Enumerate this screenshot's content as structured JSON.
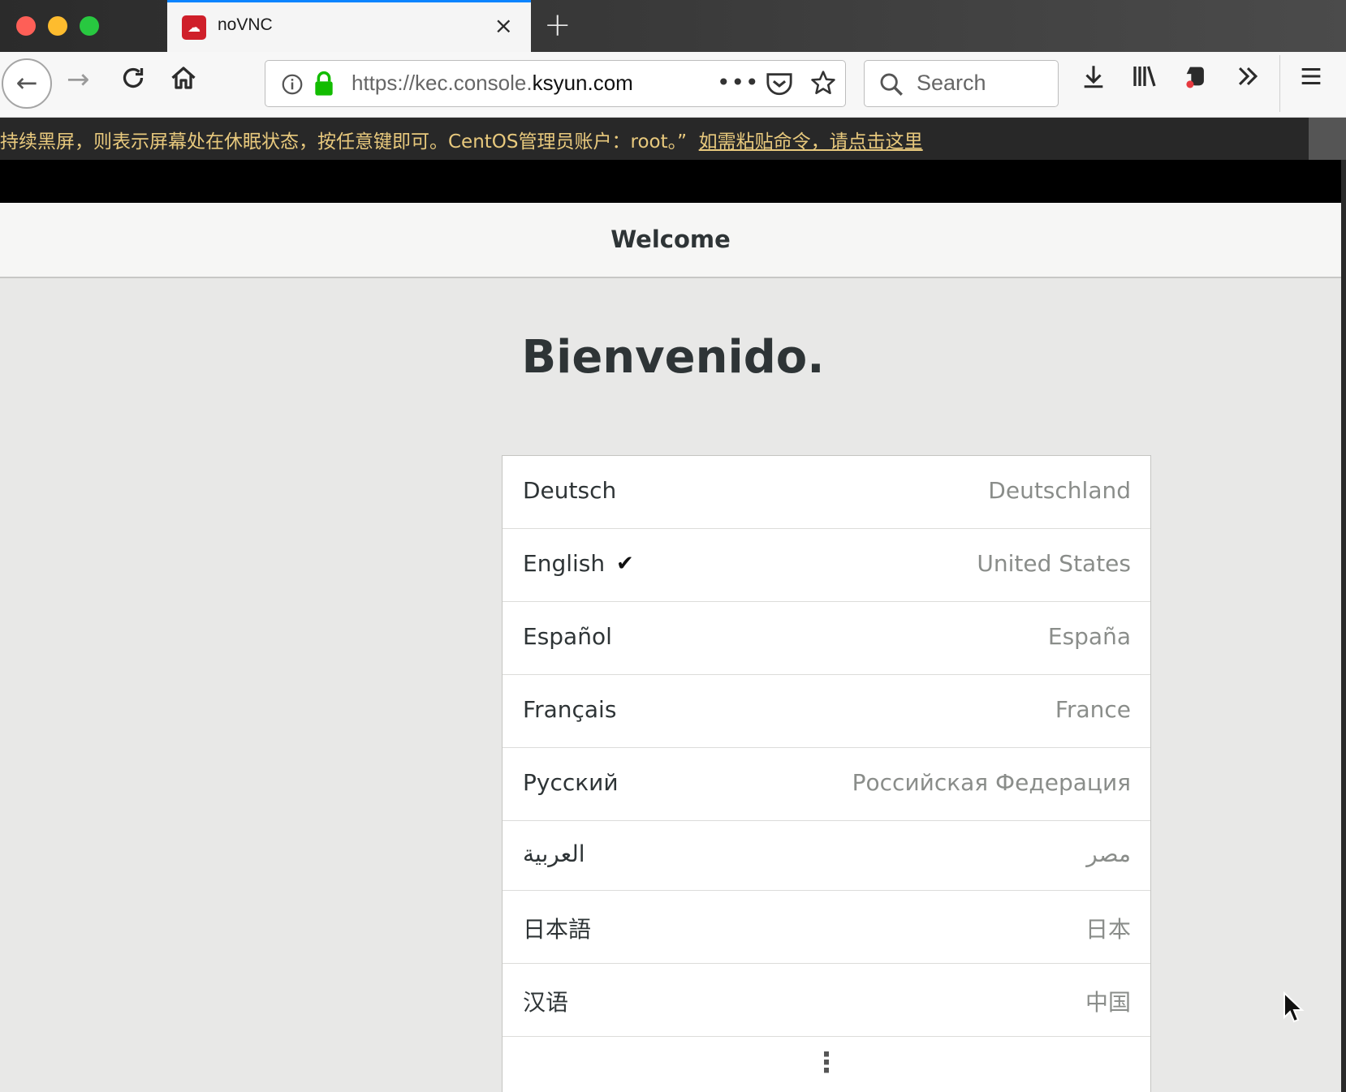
{
  "browser": {
    "tab_title": "noVNC",
    "url_prefix": "https://kec.console.",
    "url_domain": "ksyun.com",
    "search_placeholder": "Search",
    "tab_close": "×",
    "new_tab": "+"
  },
  "banner": {
    "text": "持续黑屏，则表示屏幕处在休眠状态，按任意键即可。CentOS管理员账户：root。”",
    "link": "如需粘贴命令，请点击这里"
  },
  "header": {
    "title": "Welcome"
  },
  "main": {
    "heading": "Bienvenido.",
    "languages": [
      {
        "name": "Deutsch",
        "region": "Deutschland",
        "selected": false
      },
      {
        "name": "English",
        "region": "United States",
        "selected": true
      },
      {
        "name": "Español",
        "region": "España",
        "selected": false
      },
      {
        "name": "Français",
        "region": "France",
        "selected": false
      },
      {
        "name": "Русский",
        "region": "Российская Федерация",
        "selected": false
      },
      {
        "name": "العربية",
        "region": "مصر",
        "selected": false
      },
      {
        "name": "日本語",
        "region": "日本",
        "selected": false
      },
      {
        "name": "汉语",
        "region": "中国",
        "selected": false
      }
    ],
    "check_glyph": "✔",
    "more_glyph": "⋮"
  },
  "colors": {
    "tab_accent": "#0a84ff",
    "favicon": "#cf1f2a",
    "banner_text": "#e8c97d",
    "lock_green": "#12bc00"
  }
}
